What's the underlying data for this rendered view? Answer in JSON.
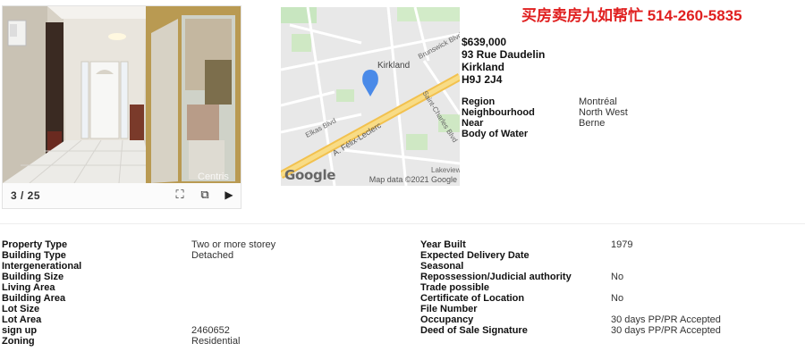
{
  "banner": {
    "phone_text": "买房卖房九如帮忙 514-260-5835"
  },
  "photo": {
    "counter": "3 / 25",
    "watermark": "Centris"
  },
  "controls": {
    "fullscreen_icon": "expand-icon",
    "copy_icon": "gallery-icon",
    "next_icon": "play-next-icon"
  },
  "map": {
    "town_label": "Kirkland",
    "road_labels": [
      "Brunswick Blvd",
      "A. Félix-Leclerc",
      "Elkas Blvd",
      "Saint-Charles Blvd",
      "Lakeview",
      "Kirkland"
    ],
    "logo": "Google",
    "credit": "Map data ©2021 Google"
  },
  "listing": {
    "price": "$639,000",
    "street": "93 Rue Daudelin",
    "city": "Kirkland",
    "postal": "H9J 2J4"
  },
  "summary": [
    {
      "label": "Region",
      "value": "Montréal"
    },
    {
      "label": "Neighbourhood",
      "value": "North West"
    },
    {
      "label": "Near",
      "value": "Berne"
    },
    {
      "label": "Body of Water",
      "value": ""
    }
  ],
  "details_left": [
    {
      "label": "Property Type",
      "value": "Two or more storey"
    },
    {
      "label": "Building Type",
      "value": "Detached"
    },
    {
      "label": "Intergenerational",
      "value": ""
    },
    {
      "label": "Building Size",
      "value": ""
    },
    {
      "label": "Living Area",
      "value": ""
    },
    {
      "label": "Building Area",
      "value": ""
    },
    {
      "label": "Lot Size",
      "value": ""
    },
    {
      "label": "Lot Area",
      "value": ""
    },
    {
      "label": "sign up",
      "value": "2460652"
    },
    {
      "label": "Zoning",
      "value": "Residential"
    }
  ],
  "details_right": [
    {
      "label": "Year Built",
      "value": "1979"
    },
    {
      "label": "Expected Delivery Date",
      "value": ""
    },
    {
      "label": "Seasonal",
      "value": ""
    },
    {
      "label": "Repossession/Judicial authority",
      "value": "No"
    },
    {
      "label": "Trade possible",
      "value": ""
    },
    {
      "label": "Certificate of Location",
      "value": "No"
    },
    {
      "label": "File Number",
      "value": ""
    },
    {
      "label": "Occupancy",
      "value": "30 days PP/PR Accepted"
    },
    {
      "label": "Deed of Sale Signature",
      "value": "30 days PP/PR Accepted"
    }
  ],
  "colors": {
    "banner": "#e02020",
    "map_pin": "#4a8ae8",
    "highway": "#f6cf6a"
  }
}
